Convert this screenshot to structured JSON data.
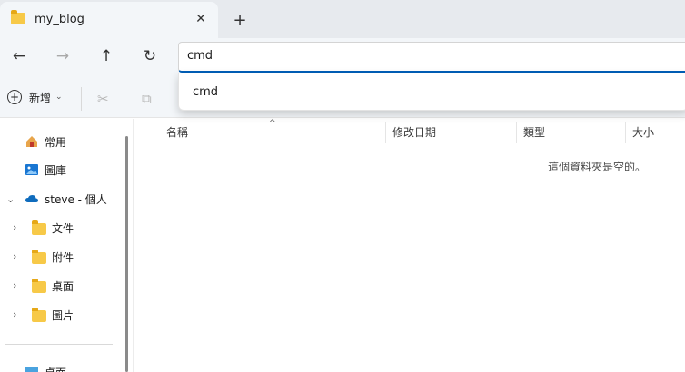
{
  "tab": {
    "title": "my_blog",
    "close": "✕",
    "new_tab": "+"
  },
  "nav": {
    "back": "←",
    "forward": "→",
    "up": "↑",
    "refresh": "↻"
  },
  "address": {
    "value": "cmd"
  },
  "suggestion": {
    "items": [
      "cmd"
    ]
  },
  "command_bar": {
    "new_label": "新增",
    "new_caret": "⌄"
  },
  "sidebar": {
    "items": [
      {
        "label": "常用"
      },
      {
        "label": "圖庫"
      },
      {
        "label": "steve - 個人"
      },
      {
        "label": "文件"
      },
      {
        "label": "附件"
      },
      {
        "label": "桌面"
      },
      {
        "label": "圖片"
      },
      {
        "label": "桌面"
      }
    ]
  },
  "columns": {
    "name": "名稱",
    "modified": "修改日期",
    "type": "類型",
    "size": "大小"
  },
  "content": {
    "empty_message": "這個資料夾是空的。"
  },
  "colors": {
    "accent": "#005fb8",
    "folder": "#f7c948",
    "onedrive": "#0f6cbd"
  }
}
